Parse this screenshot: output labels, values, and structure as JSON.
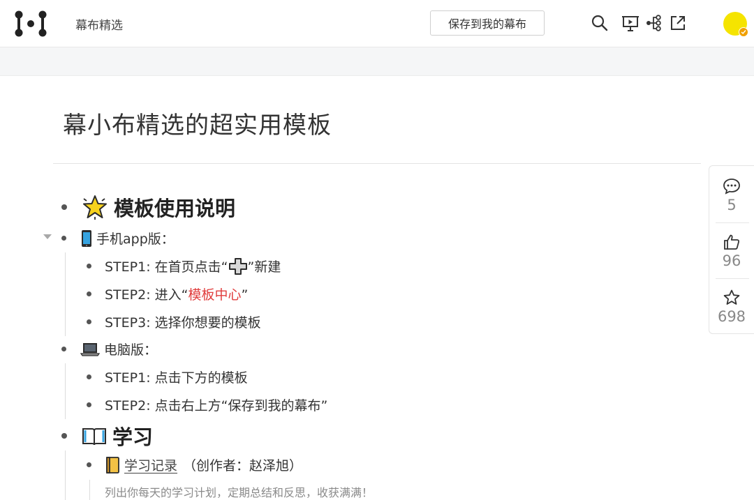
{
  "header": {
    "brand": "幕布精选",
    "save_button": "保存到我的幕布",
    "icons": [
      "search-icon",
      "present-icon",
      "mindmap-icon",
      "share-icon"
    ]
  },
  "document": {
    "title": "幕小布精选的超实用模板",
    "sections": [
      {
        "heading": "模板使用说明",
        "emoji": "star-emoji",
        "groups": [
          {
            "label": "手机app版：",
            "emoji": "phone-emoji",
            "steps": [
              {
                "prefix": "STEP1: 在首页点击“",
                "suffix": "”新建"
              },
              {
                "prefix": "STEP2: 进入“",
                "highlight": "模板中心",
                "suffix": "”"
              },
              {
                "text": "STEP3: 选择你想要的模板"
              }
            ]
          },
          {
            "label": "电脑版：",
            "emoji": "laptop-emoji",
            "steps": [
              {
                "text": "STEP1:  点击下方的模板"
              },
              {
                "text": "STEP2: 点击右上方“保存到我的幕布”"
              }
            ]
          }
        ]
      },
      {
        "heading": "学习",
        "emoji": "book-emoji",
        "items": [
          {
            "link": "学习记录",
            "author": "（创作者：赵泽旭）",
            "note": "列出你每天的学习计划，定期总结和反思，收获满满！"
          }
        ]
      }
    ]
  },
  "side_panel": {
    "comments": "5",
    "likes": "96",
    "stars": "698"
  },
  "colors": {
    "highlight": "#e03c3c",
    "avatar": "#f5e400",
    "avatar_badge": "#f0a000"
  }
}
